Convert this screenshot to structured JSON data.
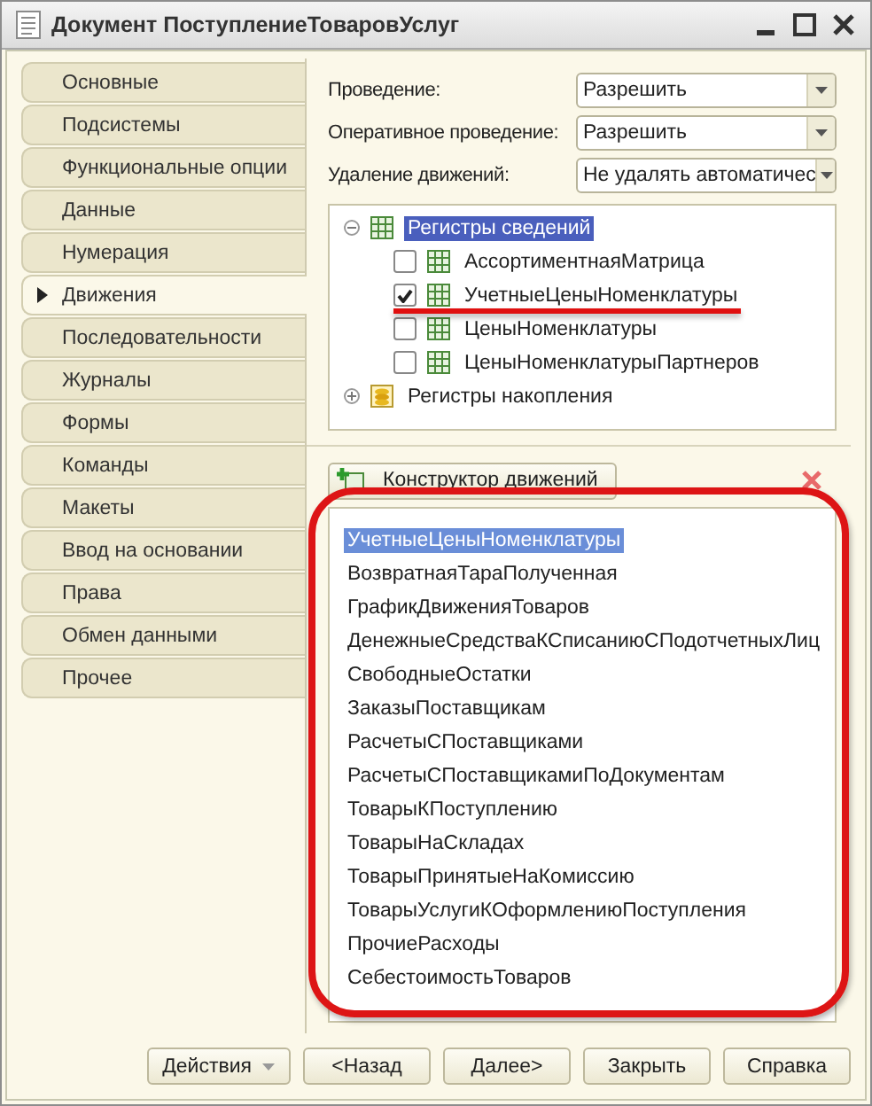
{
  "window": {
    "title": "Документ ПоступлениеТоваровУслуг"
  },
  "tabs": [
    {
      "label": "Основные",
      "selected": false
    },
    {
      "label": "Подсистемы",
      "selected": false
    },
    {
      "label": "Функциональные опции",
      "selected": false
    },
    {
      "label": "Данные",
      "selected": false
    },
    {
      "label": "Нумерация",
      "selected": false
    },
    {
      "label": "Движения",
      "selected": true
    },
    {
      "label": "Последовательности",
      "selected": false
    },
    {
      "label": "Журналы",
      "selected": false
    },
    {
      "label": "Формы",
      "selected": false
    },
    {
      "label": "Команды",
      "selected": false
    },
    {
      "label": "Макеты",
      "selected": false
    },
    {
      "label": "Ввод на основании",
      "selected": false
    },
    {
      "label": "Права",
      "selected": false
    },
    {
      "label": "Обмен данными",
      "selected": false
    },
    {
      "label": "Прочее",
      "selected": false
    }
  ],
  "fields": [
    {
      "label": "Проведение:",
      "value": "Разрешить"
    },
    {
      "label": "Оперативное проведение:",
      "value": "Разрешить"
    },
    {
      "label": "Удаление движений:",
      "value": "Не удалять автоматичес"
    }
  ],
  "tree": [
    {
      "label": "Регистры сведений",
      "kind": "info",
      "expanded": true,
      "selected": true,
      "children": [
        {
          "label": "АссортиментнаяМатрица",
          "checked": false
        },
        {
          "label": "УчетныеЦеныНоменклатуры",
          "checked": true
        },
        {
          "label": "ЦеныНоменклатуры",
          "checked": false
        },
        {
          "label": "ЦеныНоменклатурыПартнеров",
          "checked": false
        }
      ]
    },
    {
      "label": "Регистры накопления",
      "kind": "accumulation",
      "expanded": false,
      "selected": false
    }
  ],
  "constructor_button": {
    "label": "Конструктор движений"
  },
  "list": [
    {
      "label": "УчетныеЦеныНоменклатуры",
      "selected": true
    },
    {
      "label": "ВозвратнаяТараПолученная",
      "selected": false
    },
    {
      "label": "ГрафикДвиженияТоваров",
      "selected": false
    },
    {
      "label": "ДенежныеСредстваКСписаниюСПодотчетныхЛиц",
      "selected": false
    },
    {
      "label": "СвободныеОстатки",
      "selected": false
    },
    {
      "label": "ЗаказыПоставщикам",
      "selected": false
    },
    {
      "label": "РасчетыСПоставщиками",
      "selected": false
    },
    {
      "label": "РасчетыСПоставщикамиПоДокументам",
      "selected": false
    },
    {
      "label": "ТоварыКПоступлению",
      "selected": false
    },
    {
      "label": "ТоварыНаСкладах",
      "selected": false
    },
    {
      "label": "ТоварыПринятыеНаКомиссию",
      "selected": false
    },
    {
      "label": "ТоварыУслугиКОформлениюПоступления",
      "selected": false
    },
    {
      "label": "ПрочиеРасходы",
      "selected": false
    },
    {
      "label": "СебестоимостьТоваров",
      "selected": false
    }
  ],
  "buttons": [
    {
      "label": "Действия",
      "kind": "menu"
    },
    {
      "label": "<Назад",
      "kind": "plain"
    },
    {
      "label": "Далее>",
      "kind": "plain"
    },
    {
      "label": "Закрыть",
      "kind": "plain"
    },
    {
      "label": "Справка",
      "kind": "plain"
    }
  ]
}
